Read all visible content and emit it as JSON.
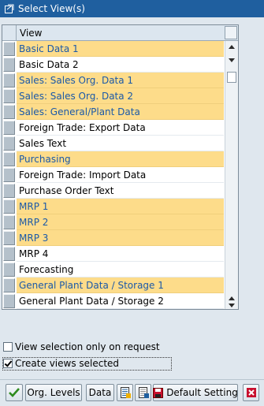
{
  "window": {
    "title": "Select View(s)",
    "icon": "window-select-icon"
  },
  "table": {
    "column_header": "View",
    "rows": [
      {
        "label": "Basic Data 1",
        "selected": true
      },
      {
        "label": "Basic Data 2",
        "selected": false
      },
      {
        "label": "Sales: Sales Org. Data 1",
        "selected": true
      },
      {
        "label": "Sales: Sales Org. Data 2",
        "selected": true
      },
      {
        "label": "Sales: General/Plant Data",
        "selected": true
      },
      {
        "label": "Foreign Trade: Export Data",
        "selected": false
      },
      {
        "label": "Sales Text",
        "selected": false
      },
      {
        "label": "Purchasing",
        "selected": true
      },
      {
        "label": "Foreign Trade: Import Data",
        "selected": false
      },
      {
        "label": "Purchase Order Text",
        "selected": false
      },
      {
        "label": "MRP 1",
        "selected": true
      },
      {
        "label": "MRP 2",
        "selected": true
      },
      {
        "label": "MRP 3",
        "selected": true
      },
      {
        "label": "MRP 4",
        "selected": false
      },
      {
        "label": "Forecasting",
        "selected": false
      },
      {
        "label": "General Plant Data / Storage 1",
        "selected": true
      },
      {
        "label": "General Plant Data / Storage 2",
        "selected": false
      }
    ]
  },
  "options": {
    "view_on_request": {
      "label": "View selection only on request",
      "checked": false
    },
    "create_selected": {
      "label": "Create views selected",
      "checked": true
    }
  },
  "toolbar": {
    "confirm_icon": "checkmark-icon",
    "org_levels_label": "Org. Levels",
    "data_label": "Data",
    "select_all_icon": "select-all-icon",
    "deselect_all_icon": "deselect-all-icon",
    "default_setting_icon": "save-icon",
    "default_setting_label": "Default Setting",
    "cancel_icon": "cancel-icon"
  },
  "colors": {
    "title_bar": "#1f5f9f",
    "selected_row": "#fddc8a",
    "selected_text": "#1b59a8",
    "background": "#dfe7ee"
  }
}
